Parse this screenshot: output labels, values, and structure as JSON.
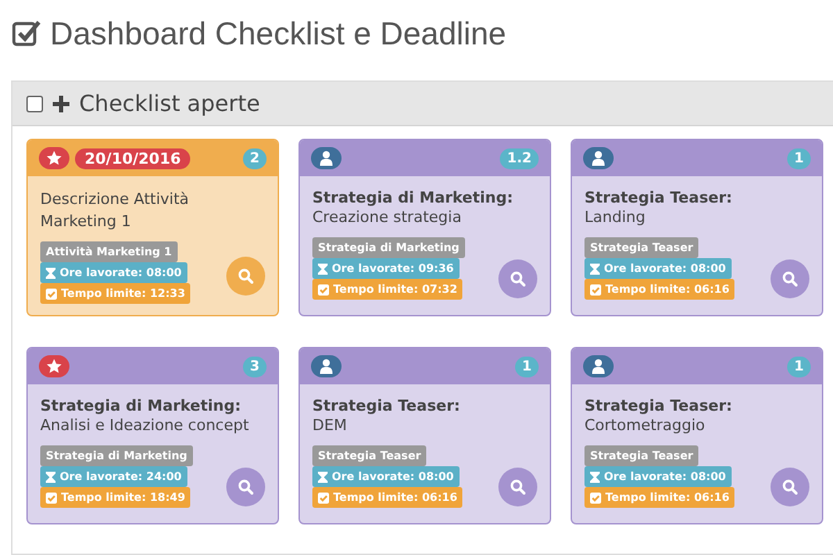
{
  "page": {
    "title": "Dashboard Checklist e Deadline"
  },
  "panel": {
    "title": "Checklist aperte",
    "checked": false
  },
  "cards": [
    {
      "color": "#f0ad4e",
      "kind": "starred",
      "date": "20/10/2016",
      "count": "2",
      "description": "Descrizione Attività Marketing 1",
      "tag": "Attività Marketing 1",
      "hours": "Ore lavorate: 08:00",
      "deadline": "Tempo limite: 12:33"
    },
    {
      "color": "#a593cf",
      "kind": "assigned",
      "count": "1.2",
      "heading": "Strategia di Marketing:",
      "description": "Creazione strategia",
      "tag": "Strategia di Marketing",
      "hours": "Ore lavorate: 09:36",
      "deadline": "Tempo limite: 07:32"
    },
    {
      "color": "#a593cf",
      "kind": "assigned",
      "count": "1",
      "heading": "Strategia Teaser:",
      "description": "Landing",
      "tag": "Strategia Teaser",
      "hours": "Ore lavorate: 08:00",
      "deadline": "Tempo limite: 06:16"
    },
    {
      "color": "#a593cf",
      "kind": "starred",
      "count": "3",
      "heading": "Strategia di Marketing:",
      "description": "Analisi e Ideazione concept",
      "tag": "Strategia di Marketing",
      "hours": "Ore lavorate: 24:00",
      "deadline": "Tempo limite: 18:49"
    },
    {
      "color": "#a593cf",
      "kind": "assigned",
      "count": "1",
      "heading": "Strategia Teaser:",
      "description": "DEM",
      "tag": "Strategia Teaser",
      "hours": "Ore lavorate: 08:00",
      "deadline": "Tempo limite: 06:16"
    },
    {
      "color": "#a593cf",
      "kind": "assigned",
      "count": "1",
      "heading": "Strategia Teaser:",
      "description": "Cortometraggio",
      "tag": "Strategia Teaser",
      "hours": "Ore lavorate: 08:00",
      "deadline": "Tempo limite: 06:16"
    }
  ]
}
